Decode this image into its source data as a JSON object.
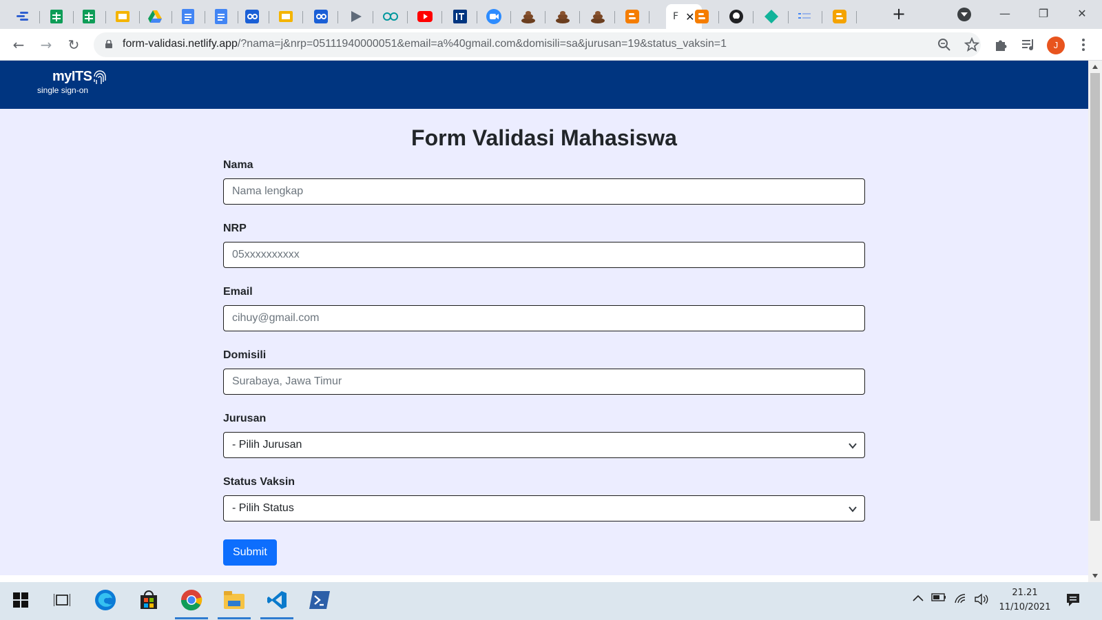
{
  "browser": {
    "active_tab_letter": "F",
    "url_host": "form-validasi.netlify.app",
    "url_rest": "/?nama=j&nrp=05111940000051&email=a%40gmail.com&domisili=sa&jurusan=19&status_vaksin=1",
    "profile_initial": "J",
    "new_tab_label": "+"
  },
  "site": {
    "logo_main": "myITS",
    "logo_sub": "single sign-on"
  },
  "form": {
    "title": "Form Validasi Mahasiswa",
    "nama": {
      "label": "Nama",
      "placeholder": "Nama lengkap"
    },
    "nrp": {
      "label": "NRP",
      "placeholder": "05xxxxxxxxxx"
    },
    "email": {
      "label": "Email",
      "placeholder": "cihuy@gmail.com"
    },
    "domisili": {
      "label": "Domisili",
      "placeholder": "Surabaya, Jawa Timur"
    },
    "jurusan": {
      "label": "Jurusan",
      "selected": "- Pilih Jurusan"
    },
    "status_vaksin": {
      "label": "Status Vaksin",
      "selected": "- Pilih Status"
    },
    "submit_label": "Submit"
  },
  "taskbar": {
    "time": "21.21",
    "date": "11/10/2021"
  },
  "colors": {
    "site_header": "#003580",
    "page_background": "#ecedff",
    "submit_button": "#0d6efd"
  }
}
